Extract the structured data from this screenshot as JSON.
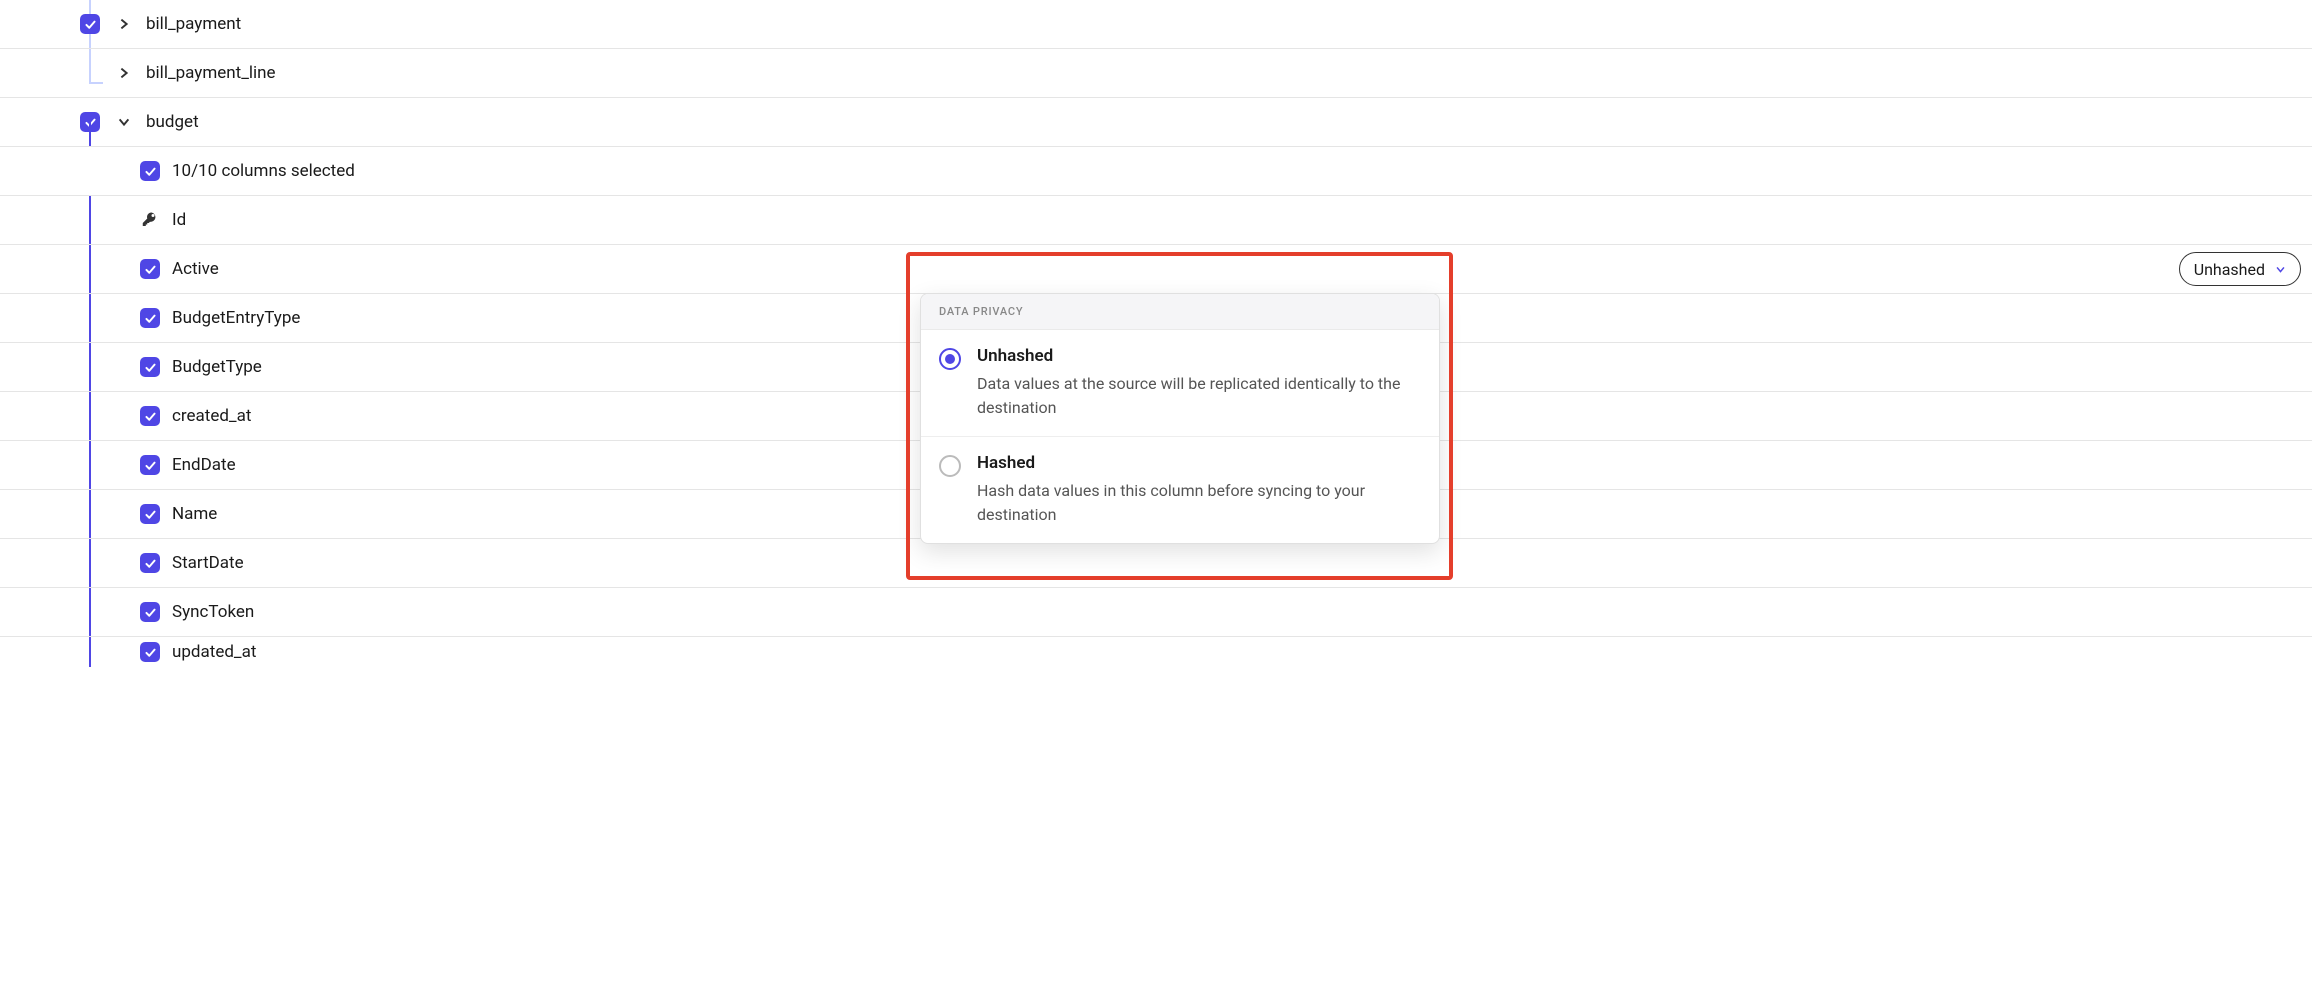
{
  "tree": {
    "bill_payment": {
      "label": "bill_payment",
      "checked": true,
      "expanded": false
    },
    "bill_payment_line": {
      "label": "bill_payment_line"
    },
    "budget": {
      "label": "budget",
      "checked": true,
      "expanded": true,
      "columns_summary": "10/10 columns selected",
      "columns": [
        {
          "label": "Id",
          "is_key": true
        },
        {
          "label": "Active",
          "checked": true,
          "has_dropdown": true
        },
        {
          "label": "BudgetEntryType",
          "checked": true
        },
        {
          "label": "BudgetType",
          "checked": true
        },
        {
          "label": "created_at",
          "checked": true
        },
        {
          "label": "EndDate",
          "checked": true
        },
        {
          "label": "Name",
          "checked": true
        },
        {
          "label": "StartDate",
          "checked": true
        },
        {
          "label": "SyncToken",
          "checked": true
        },
        {
          "label": "updated_at",
          "checked": true
        }
      ]
    }
  },
  "dropdown": {
    "label": "Unhashed"
  },
  "popover": {
    "header": "DATA PRIVACY",
    "options": [
      {
        "title": "Unhashed",
        "desc": "Data values at the source will be replicated identically to the destination",
        "selected": true
      },
      {
        "title": "Hashed",
        "desc": "Hash data values in this column before syncing to your destination",
        "selected": false
      }
    ]
  }
}
